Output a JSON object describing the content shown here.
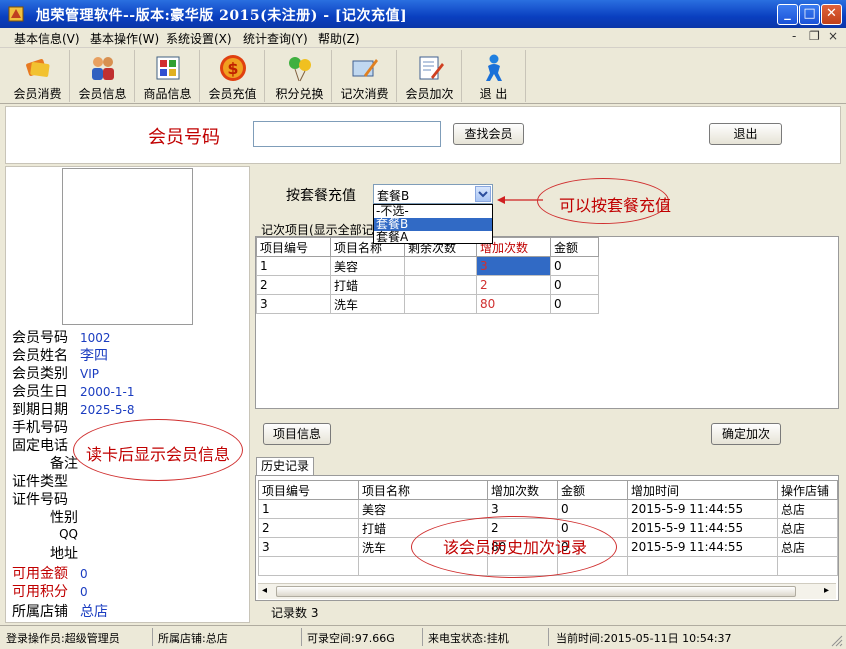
{
  "window": {
    "title": "旭荣管理软件--版本:豪华版  2015(未注册) - [记次充值]",
    "min": "_",
    "max": "□",
    "close": "✕"
  },
  "menu": {
    "items": [
      "基本信息(V)",
      "基本操作(W)",
      "系统设置(X)",
      "统计查询(Y)",
      "帮助(Z)"
    ],
    "mdi_min": "-",
    "mdi_restore": "❐",
    "mdi_close": "×"
  },
  "toolbar": {
    "items": [
      {
        "label": "会员消费",
        "icon": "cards-icon"
      },
      {
        "label": "会员信息",
        "icon": "members-icon"
      },
      {
        "label": "商品信息",
        "icon": "grid-icon"
      },
      {
        "label": "会员充值",
        "icon": "dollar-icon"
      },
      {
        "label": "积分兑换",
        "icon": "balloons-icon"
      },
      {
        "label": "记次消费",
        "icon": "card-pen-icon"
      },
      {
        "label": "会员加次",
        "icon": "memo-pen-icon"
      },
      {
        "label": "退 出",
        "icon": "person-exit-icon"
      }
    ]
  },
  "search": {
    "label": "会员号码",
    "value": "",
    "find_button": "查找会员",
    "exit_button": "退出"
  },
  "member": {
    "fields": [
      {
        "key": "会员号码",
        "value": "1002"
      },
      {
        "key": "会员姓名",
        "value": "李四"
      },
      {
        "key": "会员类别",
        "value": "VIP"
      },
      {
        "key": "会员生日",
        "value": "2000-1-1"
      },
      {
        "key": "到期日期",
        "value": "2025-5-8"
      },
      {
        "key": "手机号码",
        "value": ""
      },
      {
        "key": "固定电话",
        "value": ""
      },
      {
        "key": "备注",
        "value": ""
      },
      {
        "key": "证件类型",
        "value": ""
      },
      {
        "key": "证件号码",
        "value": ""
      },
      {
        "key": "性别",
        "value": ""
      },
      {
        "key": "QQ",
        "value": ""
      },
      {
        "key": "地址",
        "value": ""
      },
      {
        "key": "可用金额",
        "value": "0"
      },
      {
        "key": "可用积分",
        "value": "0"
      },
      {
        "key": "所属店铺",
        "value": "总店"
      }
    ],
    "annotation": "读卡后显示会员信息"
  },
  "package": {
    "label": "按套餐充值",
    "selected": "套餐B",
    "options": [
      "-不选-",
      "套餐B",
      "套餐A"
    ],
    "highlighted": "套餐B",
    "annotation": "可以按套餐充值"
  },
  "items_group": {
    "title": "记次项目(显示全部记",
    "columns": [
      "项目编号",
      "项目名称",
      "剩余次数",
      "增加次数",
      "金额"
    ],
    "rows": [
      [
        "1",
        "美容",
        "",
        "3",
        "0"
      ],
      [
        "2",
        "打蜡",
        "",
        "2",
        "0"
      ],
      [
        "3",
        "洗车",
        "",
        "80",
        "0"
      ]
    ],
    "info_button": "项目信息",
    "confirm_button": "确定加次"
  },
  "history": {
    "tab": "历史记录",
    "columns": [
      "项目编号",
      "项目名称",
      "增加次数",
      "金额",
      "增加时间",
      "操作店铺"
    ],
    "rows": [
      [
        "1",
        "美容",
        "3",
        "0",
        "2015-5-9 11:44:55",
        "总店"
      ],
      [
        "2",
        "打蜡",
        "2",
        "0",
        "2015-5-9 11:44:55",
        "总店"
      ],
      [
        "3",
        "洗车",
        "80",
        "0",
        "2015-5-9 11:44:55",
        "总店"
      ]
    ],
    "record_count": "记录数 3",
    "annotation": "该会员历史加次记录"
  },
  "status": {
    "operator": "登录操作员:超级管理员",
    "shop": "所属店铺:总店",
    "space": "可录空间:97.66G",
    "phone": "来电宝状态:挂机",
    "time": "当前时间:2015-05-11日  10:54:37"
  },
  "colors": {
    "title_bar": "#0a3fc0",
    "label_red": "#c00000",
    "value_blue": "#1a3cc0",
    "highlight": "#316ac5"
  }
}
